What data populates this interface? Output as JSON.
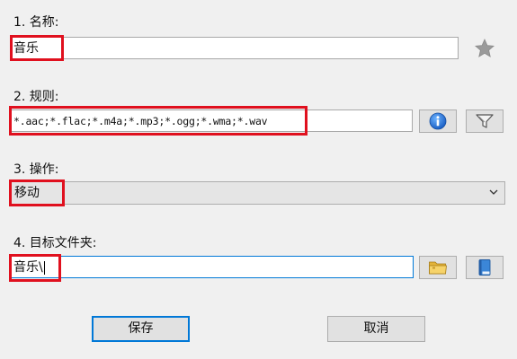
{
  "form": {
    "name": {
      "label": "1. 名称:",
      "value": "音乐"
    },
    "rules": {
      "label": "2. 规则:",
      "value": "*.aac;*.flac;*.m4a;*.mp3;*.ogg;*.wma;*.wav"
    },
    "operation": {
      "label": "3. 操作:",
      "value": "移动"
    },
    "target_folder": {
      "label": "4. 目标文件夹:",
      "value": "音乐\\"
    }
  },
  "buttons": {
    "save_label": "保存",
    "cancel_label": "取消"
  },
  "icons": {
    "favorite": "star-icon",
    "info": "info-icon",
    "filter": "filter-icon",
    "folder": "folder-icon",
    "book": "book-icon",
    "dropdown": "chevron-down-icon"
  },
  "colors": {
    "highlight": "#e0101e",
    "focus": "#0078d7",
    "info_blue": "#1a6fd1"
  }
}
